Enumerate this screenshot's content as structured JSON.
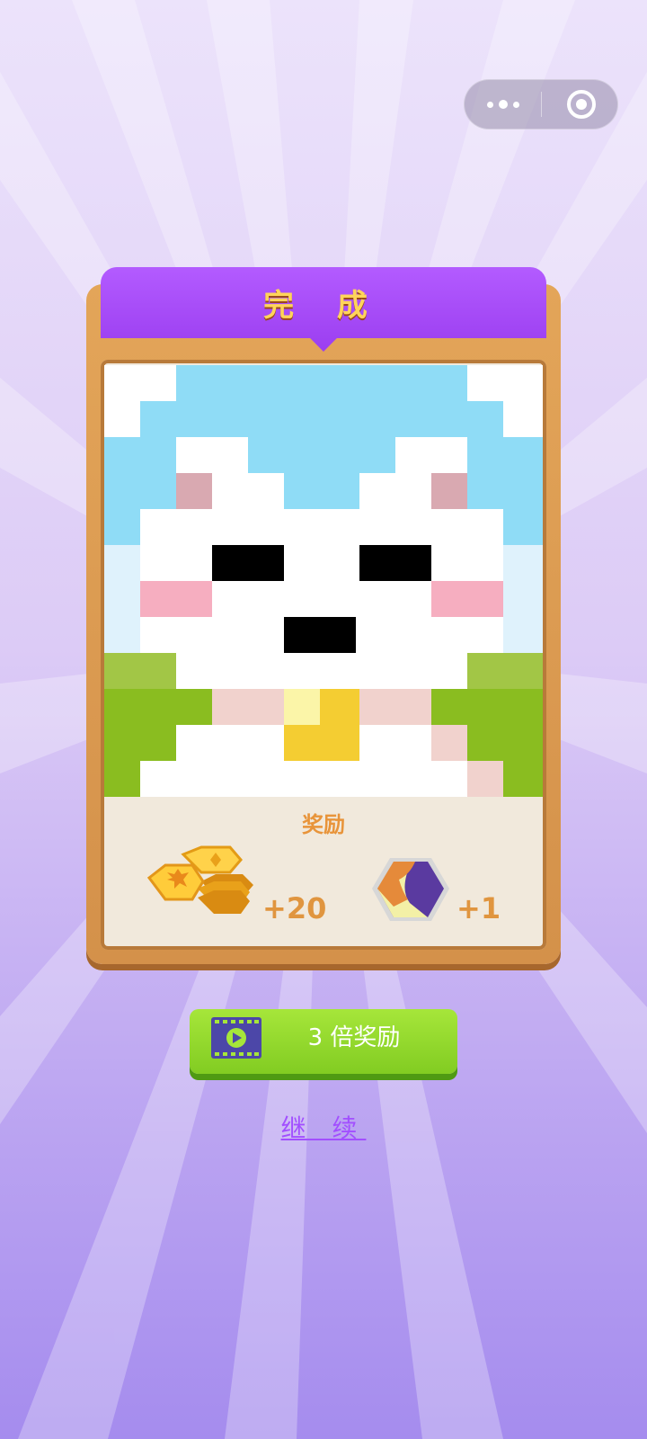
{
  "header": {
    "capsule": {
      "more_icon": "more-dots-icon",
      "close_icon": "target-circle-icon"
    }
  },
  "panel": {
    "title": "完 成",
    "reward_label": "奖励",
    "rewards": [
      {
        "icon": "gold-coins-icon",
        "value": "+20"
      },
      {
        "icon": "hex-puzzle-piece-icon",
        "value": "+1"
      }
    ]
  },
  "actions": {
    "triple_button_label": "3 倍奖励",
    "continue_label": "继 续"
  },
  "colors": {
    "title": "#ffd45a",
    "ribbon": "#a24fff",
    "button": "#8bd02a",
    "continue": "#a24fff",
    "sky": "#8fdcf6",
    "grass": "#8abd20"
  }
}
